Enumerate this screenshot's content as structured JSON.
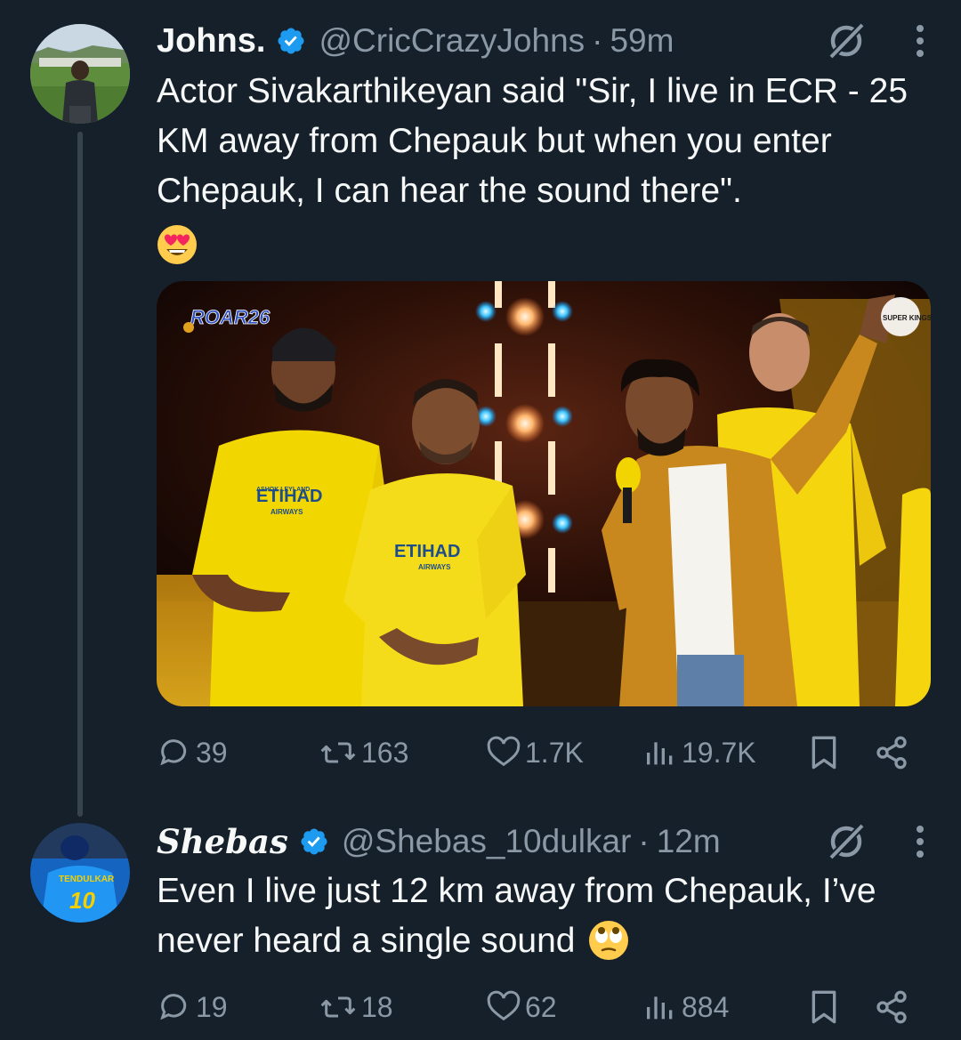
{
  "tweets": [
    {
      "display_name": "Johns.",
      "handle": "@CricCrazyJohns",
      "dot": "·",
      "time": "59m",
      "text": "Actor Sivakarthikeyan said \"Sir, I live in ECR - 25 KM away from Chepauk but when you enter Chepauk, I can hear the sound there\".",
      "emoji": "heart-eyes-emoji",
      "media": {
        "watermark_left": "ROAR26",
        "watermark_right": "SUPER KINGS",
        "jersey_sponsor": "ETIHAD",
        "jersey_sub": "AIRWAYS",
        "jersey_top": "ASHOK LEYLAND"
      },
      "stats": {
        "replies": "39",
        "reposts": "163",
        "likes": "1.7K",
        "views": "19.7K"
      }
    },
    {
      "display_name": "Shebas",
      "handle": "@Shebas_10dulkar",
      "dot": "·",
      "time": "12m",
      "text": "Even I live just 12 km away from Chepauk, I’ve never heard a single sound",
      "emoji": "eye-roll-emoji",
      "avatar_text": "TENDULKAR",
      "avatar_number": "10",
      "stats": {
        "replies": "19",
        "reposts": "18",
        "likes": "62",
        "views": "884"
      }
    }
  ],
  "colors": {
    "background": "#15202b",
    "text": "#f7f9f9",
    "secondary": "#8b98a5",
    "verified": "#1d9bf0",
    "thread_line": "#38444d"
  }
}
